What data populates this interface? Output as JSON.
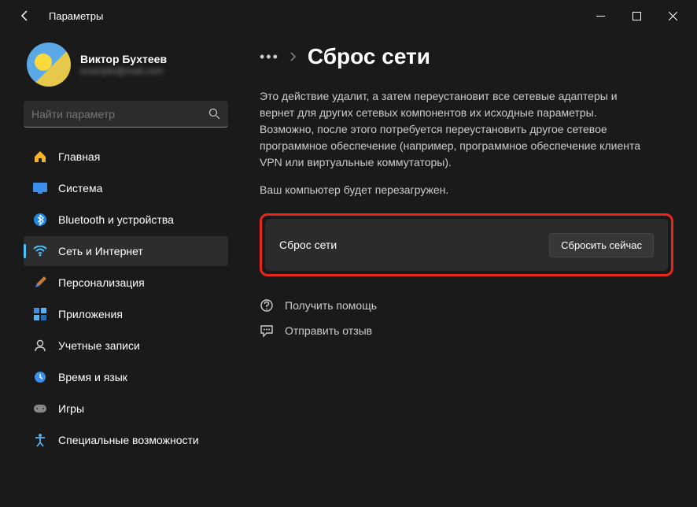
{
  "window": {
    "title": "Параметры"
  },
  "profile": {
    "name": "Виктор Бухтеев",
    "email": "example@mail.com"
  },
  "search": {
    "placeholder": "Найти параметр"
  },
  "sidebar": {
    "items": [
      {
        "label": "Главная",
        "icon": "home"
      },
      {
        "label": "Система",
        "icon": "system"
      },
      {
        "label": "Bluetooth и устройства",
        "icon": "bluetooth"
      },
      {
        "label": "Сеть и Интернет",
        "icon": "network",
        "active": true
      },
      {
        "label": "Персонализация",
        "icon": "personalize"
      },
      {
        "label": "Приложения",
        "icon": "apps"
      },
      {
        "label": "Учетные записи",
        "icon": "accounts"
      },
      {
        "label": "Время и язык",
        "icon": "time"
      },
      {
        "label": "Игры",
        "icon": "gaming"
      },
      {
        "label": "Специальные возможности",
        "icon": "accessibility"
      }
    ]
  },
  "main": {
    "page_title": "Сброс сети",
    "description": "Это действие удалит, а затем переустановит все сетевые адаптеры и вернет для других сетевых компонентов их исходные параметры. Возможно, после этого потребуется переустановить другое сетевое программное обеспечение (например, программное обеспечение клиента VPN или виртуальные коммутаторы).",
    "restart_note": "Ваш компьютер будет перезагружен.",
    "reset_card_label": "Сброс сети",
    "reset_button": "Сбросить сейчас",
    "help_link": "Получить помощь",
    "feedback_link": "Отправить отзыв"
  }
}
